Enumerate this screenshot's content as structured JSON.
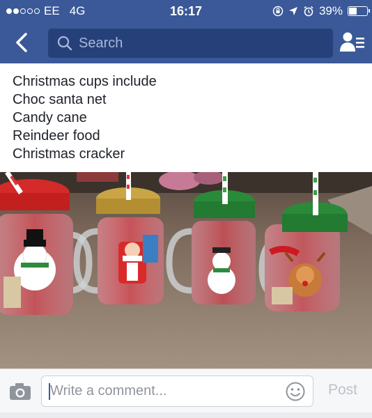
{
  "status_bar": {
    "carrier": "EE",
    "network": "4G",
    "time": "16:17",
    "battery": "39%",
    "battery_level": 0.39,
    "signal_bars_filled": 2,
    "signal_bars_total": 5
  },
  "nav": {
    "search_placeholder": "Search",
    "icons": [
      "back-chevron-icon",
      "search-icon",
      "friend-requests-icon"
    ]
  },
  "post": {
    "lines": [
      "Christmas cups include",
      "Choc santa net",
      "Candy cane",
      "Reindeer food",
      "Christmas cracker"
    ]
  },
  "photo": {
    "subject": "four Christmas mason jar mugs with straws"
  },
  "comment_bar": {
    "placeholder": "Write a comment...",
    "post_label": "Post",
    "icons": [
      "camera-icon",
      "smiley-icon"
    ]
  },
  "colors": {
    "brand": "#3b5998",
    "search_bg": "#26407a",
    "post_disabled": "#bec3c9"
  }
}
